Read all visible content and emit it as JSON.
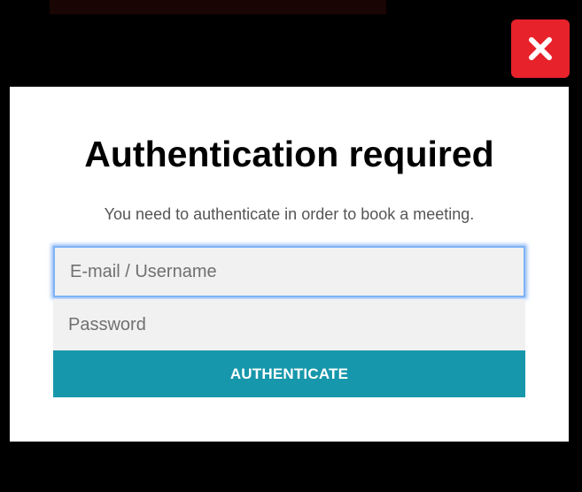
{
  "close_button": {
    "icon": "close-icon"
  },
  "modal": {
    "title": "Authentication required",
    "subtitle": "You need to authenticate in order to book a meeting.",
    "email_placeholder": "E-mail / Username",
    "email_value": "",
    "password_placeholder": "Password",
    "password_value": "",
    "submit_label": "AUTHENTICATE"
  },
  "colors": {
    "accent": "#1797ab",
    "close": "#e8222a",
    "focus": "#7fb3f5"
  }
}
